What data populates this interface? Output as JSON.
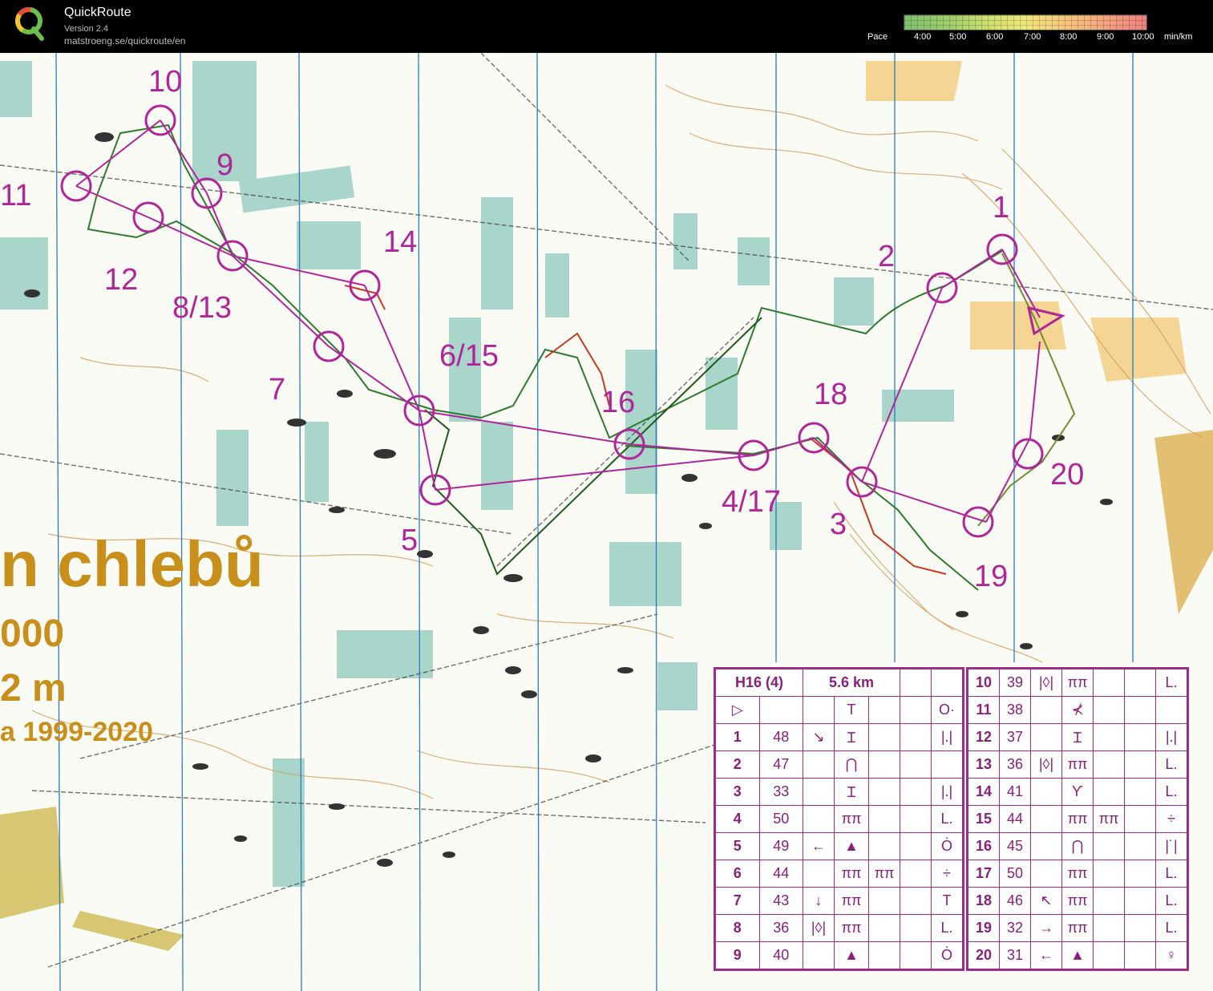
{
  "app": {
    "title": "QuickRoute",
    "version": "Version 2.4",
    "url": "matstroeng.se/quickroute/en"
  },
  "pace_scale": {
    "label": "Pace",
    "ticks": [
      "4:00",
      "5:00",
      "6:00",
      "7:00",
      "8:00",
      "9:00",
      "10:00"
    ],
    "unit": "min/km",
    "colors": [
      "#7ec06c",
      "#cfe06f",
      "#f0e77a",
      "#f7c97d",
      "#ef7f80"
    ]
  },
  "map": {
    "title_lines": [
      "n chlebů",
      "000",
      "2 m",
      "a 1999-2020"
    ],
    "control_labels": [
      "10",
      "9",
      "11",
      "12",
      "8/13",
      "14",
      "7",
      "6/15",
      "16",
      "5",
      "4/17",
      "18",
      "3",
      "2",
      "1",
      "19",
      "20"
    ],
    "colors": {
      "course": "#b0259a",
      "route_green": "#2d7a2d",
      "route_red": "#c83a1e",
      "magnetic_lines": "#2a7cc0"
    }
  },
  "description": {
    "header": {
      "class": "H16 (4)",
      "length": "5.6 km"
    },
    "start_symbols": [
      "▷",
      "",
      "",
      "T",
      "",
      "",
      "O·"
    ],
    "left_rows": [
      {
        "num": "1",
        "code": "48",
        "c": "↘",
        "d": "Ɪ",
        "e": "",
        "f": "",
        "g": "|.|"
      },
      {
        "num": "2",
        "code": "47",
        "c": "",
        "d": "⋂",
        "e": "",
        "f": "",
        "g": ""
      },
      {
        "num": "3",
        "code": "33",
        "c": "",
        "d": "Ɪ",
        "e": "",
        "f": "",
        "g": "|.|"
      },
      {
        "num": "4",
        "code": "50",
        "c": "",
        "d": "ππ",
        "e": "",
        "f": "",
        "g": "L."
      },
      {
        "num": "5",
        "code": "49",
        "c": "←",
        "d": "▲",
        "e": "",
        "f": "",
        "g": "Ȯ"
      },
      {
        "num": "6",
        "code": "44",
        "c": "",
        "d": "ππ",
        "e": "ππ",
        "f": "",
        "g": "÷"
      },
      {
        "num": "7",
        "code": "43",
        "c": "↓",
        "d": "ππ",
        "e": "",
        "f": "",
        "g": "T"
      },
      {
        "num": "8",
        "code": "36",
        "c": "|◊|",
        "d": "ππ",
        "e": "",
        "f": "",
        "g": "L."
      },
      {
        "num": "9",
        "code": "40",
        "c": "",
        "d": "▲",
        "e": "",
        "f": "",
        "g": "Ȯ"
      }
    ],
    "right_rows": [
      {
        "num": "10",
        "code": "39",
        "c": "|◊|",
        "d": "ππ",
        "e": "",
        "f": "",
        "g": "L."
      },
      {
        "num": "11",
        "code": "38",
        "c": "",
        "d": "⊀",
        "e": "",
        "f": "",
        "g": ""
      },
      {
        "num": "12",
        "code": "37",
        "c": "",
        "d": "Ɪ",
        "e": "",
        "f": "",
        "g": "|.|"
      },
      {
        "num": "13",
        "code": "36",
        "c": "|◊|",
        "d": "ππ",
        "e": "",
        "f": "",
        "g": "L."
      },
      {
        "num": "14",
        "code": "41",
        "c": "",
        "d": "Ƴ",
        "e": "",
        "f": "",
        "g": "L."
      },
      {
        "num": "15",
        "code": "44",
        "c": "",
        "d": "ππ",
        "e": "ππ",
        "f": "",
        "g": "÷"
      },
      {
        "num": "16",
        "code": "45",
        "c": "",
        "d": "⋂",
        "e": "",
        "f": "",
        "g": "|˙|"
      },
      {
        "num": "17",
        "code": "50",
        "c": "",
        "d": "ππ",
        "e": "",
        "f": "",
        "g": "L."
      },
      {
        "num": "18",
        "code": "46",
        "c": "↖",
        "d": "ππ",
        "e": "",
        "f": "",
        "g": "L."
      },
      {
        "num": "19",
        "code": "32",
        "c": "→",
        "d": "ππ",
        "e": "",
        "f": "",
        "g": "L."
      },
      {
        "num": "20",
        "code": "31",
        "c": "←",
        "d": "▲",
        "e": "",
        "f": "",
        "g": "♀"
      }
    ]
  }
}
